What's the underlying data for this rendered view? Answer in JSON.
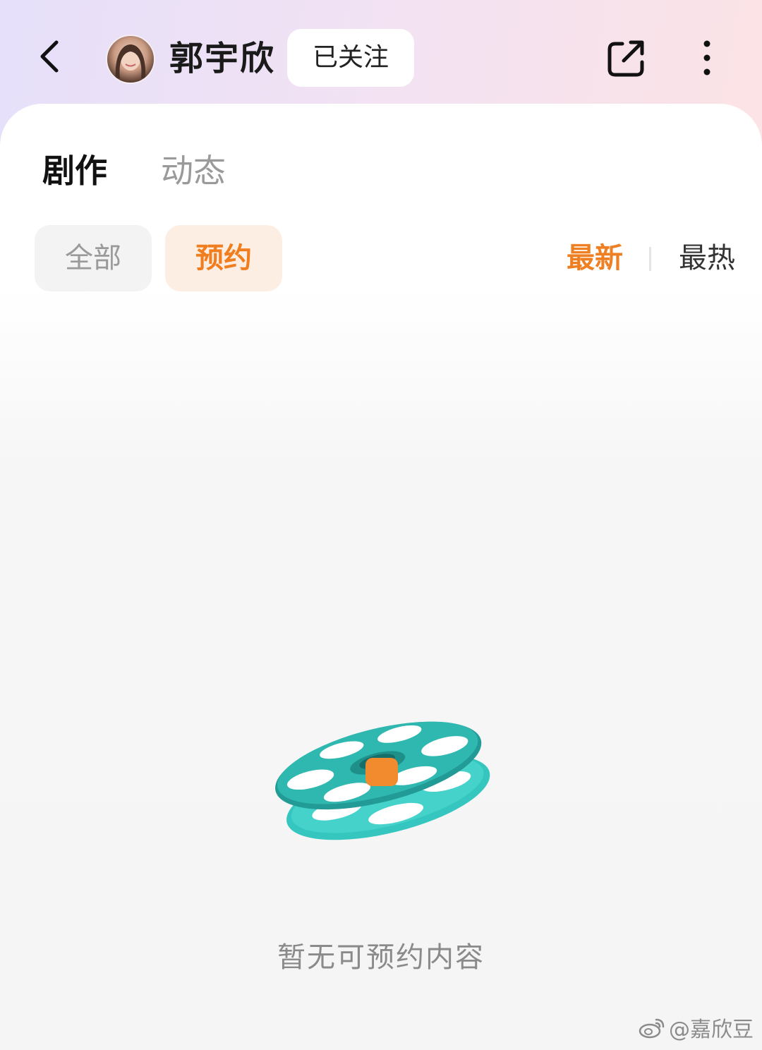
{
  "header": {
    "user_name": "郭宇欣",
    "follow_label": "已关注",
    "icons": [
      "back-icon",
      "share-icon",
      "more-icon"
    ]
  },
  "tabs": [
    {
      "label": "剧作",
      "active": true
    },
    {
      "label": "动态",
      "active": false
    }
  ],
  "filters": [
    {
      "label": "全部",
      "active": false
    },
    {
      "label": "预约",
      "active": true
    }
  ],
  "sort": [
    {
      "label": "最新",
      "active": true
    },
    {
      "label": "最热",
      "active": false
    }
  ],
  "empty_state": {
    "message": "暂无可预约内容",
    "illustration": "film-reel-icon"
  },
  "watermark": {
    "text": "@嘉欣豆"
  },
  "colors": {
    "accent": "#ee7f22",
    "chip_active_bg": "#fdeee4",
    "reel_teal": "#2eb8b0",
    "reel_orange": "#f28a2e"
  }
}
